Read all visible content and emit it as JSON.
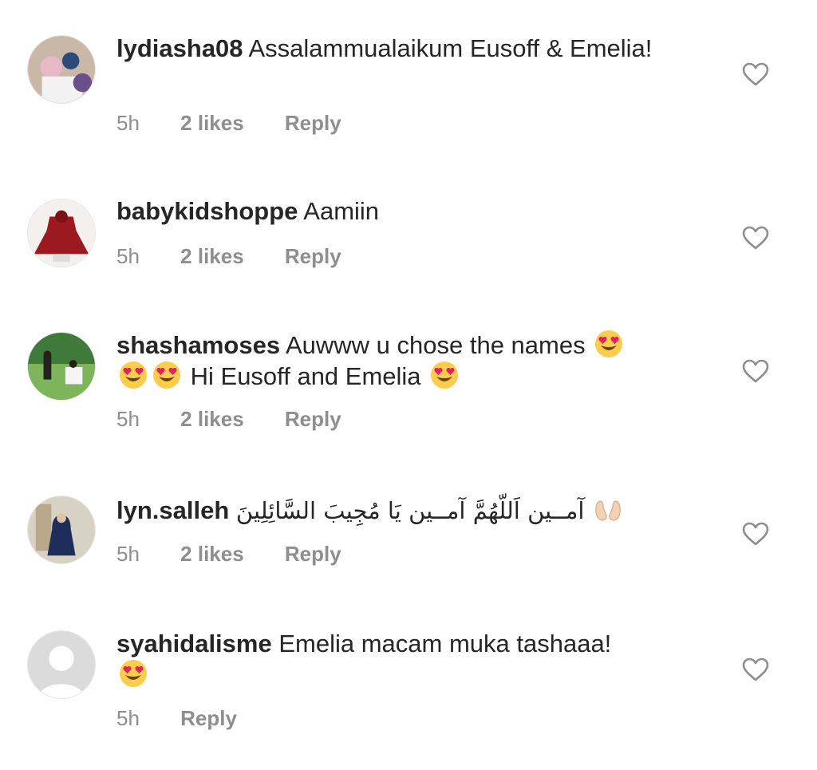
{
  "comments": [
    {
      "username": "lydiasha08",
      "text": "Assalammualaikum Eusoff & Emelia!",
      "time": "5h",
      "likes": "2 likes",
      "reply": "Reply"
    },
    {
      "username": "babykidshoppe",
      "text": "Aamiin",
      "time": "5h",
      "likes": "2 likes",
      "reply": "Reply"
    },
    {
      "username": "shashamoses",
      "text_a": "Auwww u chose the names",
      "text_b": "Hi Eusoff and Emelia",
      "time": "5h",
      "likes": "2 likes",
      "reply": "Reply"
    },
    {
      "username": "lyn.salleh",
      "text": "آمــين اَللّهُمَّ آمــين يَا مُجِيبَ السَّائِلِينَ",
      "time": "5h",
      "likes": "2 likes",
      "reply": "Reply"
    },
    {
      "username": "syahidalisme",
      "text": "Emelia macam muka tashaaa!",
      "time": "5h",
      "reply": "Reply"
    }
  ],
  "icons": {
    "like": "heart-outline-icon",
    "heart_eyes": "heart-eyes-emoji",
    "hands": "palms-up-emoji"
  }
}
